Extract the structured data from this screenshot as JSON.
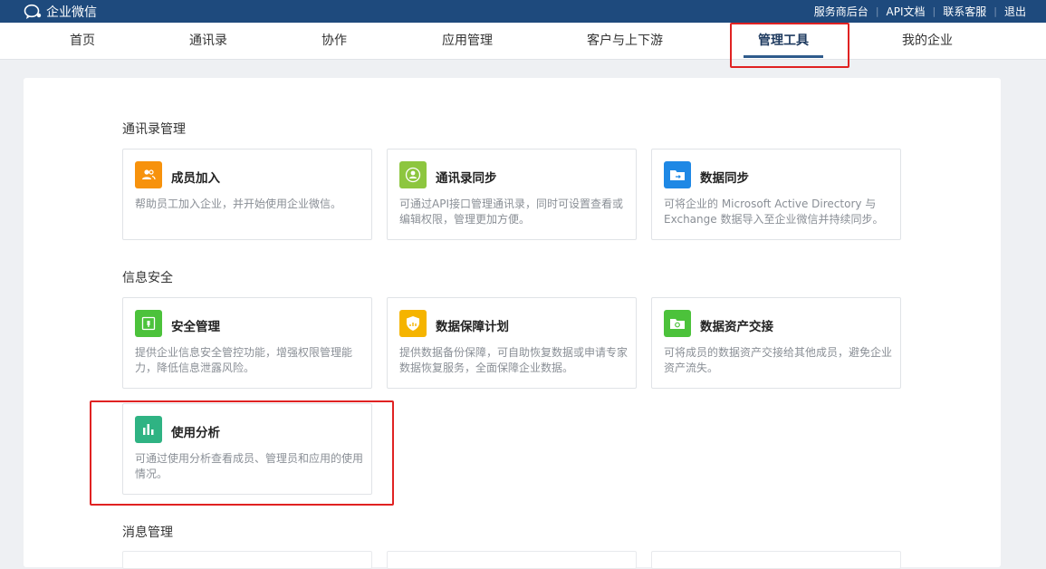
{
  "brand": {
    "name": "企业微信"
  },
  "toplinks": [
    "服务商后台",
    "API文档",
    "联系客服",
    "退出"
  ],
  "nav": {
    "items": [
      "首页",
      "通讯录",
      "协作",
      "应用管理",
      "客户与上下游",
      "管理工具",
      "我的企业"
    ],
    "active": "管理工具"
  },
  "sections": [
    {
      "title": "通讯录管理",
      "cards": [
        {
          "title": "成员加入",
          "desc": "帮助员工加入企业，并开始使用企业微信。",
          "icon": "users-icon",
          "color": "#f7920c"
        },
        {
          "title": "通讯录同步",
          "desc": "可通过API接口管理通讯录，同时可设置查看或编辑权限，管理更加方便。",
          "icon": "contact-sync-icon",
          "color": "#8dc63f"
        },
        {
          "title": "数据同步",
          "desc": "可将企业的 Microsoft Active Directory 与 Exchange 数据导入至企业微信并持续同步。",
          "icon": "folder-sync-icon",
          "color": "#1e88e5"
        }
      ]
    },
    {
      "title": "信息安全",
      "cards": [
        {
          "title": "安全管理",
          "desc": "提供企业信息安全管控功能，增强权限管理能力，降低信息泄露风险。",
          "icon": "safe-icon",
          "color": "#4cc23b"
        },
        {
          "title": "数据保障计划",
          "desc": "提供数据备份保障，可自助恢复数据或申请专家数据恢复服务，全面保障企业数据。",
          "icon": "shield-icon",
          "color": "#f5b400"
        },
        {
          "title": "数据资产交接",
          "desc": "可将成员的数据资产交接给其他成员，避免企业资产流失。",
          "icon": "folder-transfer-icon",
          "color": "#4cc23b"
        },
        {
          "title": "使用分析",
          "desc": "可通过使用分析查看成员、管理员和应用的使用情况。",
          "icon": "bar-chart-icon",
          "color": "#2fb383"
        }
      ]
    },
    {
      "title": "消息管理",
      "cards": []
    }
  ],
  "colors": {
    "topbar": "#1e4a7d",
    "highlight": "#e02222"
  }
}
